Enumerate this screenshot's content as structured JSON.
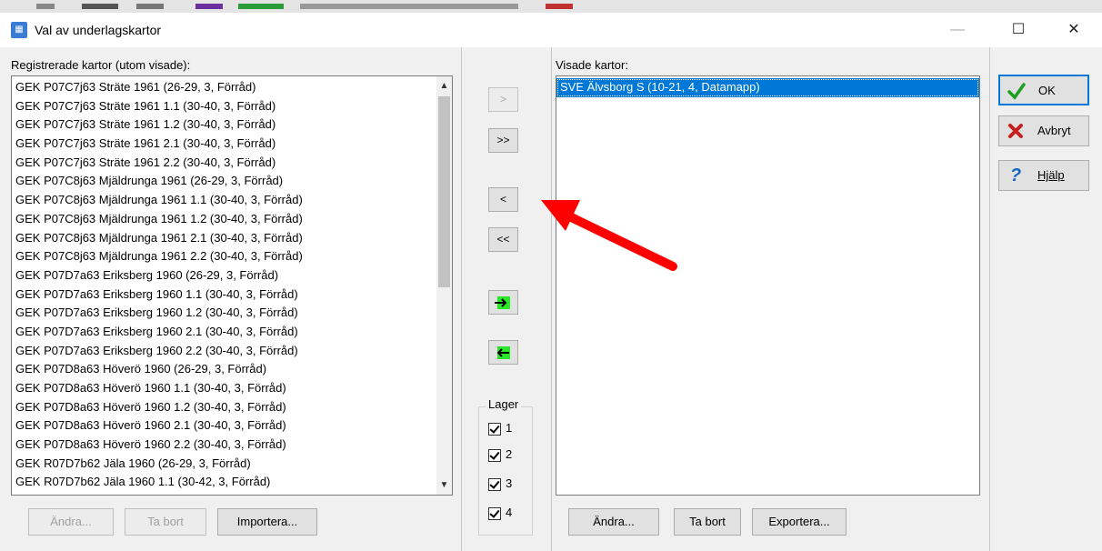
{
  "window": {
    "title": "Val av underlagskartor",
    "minimize_glyph": "—",
    "maximize_glyph": "☐",
    "close_glyph": "✕"
  },
  "left": {
    "label": "Registrerade kartor (utom visade):",
    "items": [
      "GEK P07C7j63 Sträte  1961 (26-29, 3, Förråd)",
      "GEK P07C7j63 Sträte  1961 1.1 (30-40, 3, Förråd)",
      "GEK P07C7j63 Sträte  1961 1.2 (30-40, 3, Förråd)",
      "GEK P07C7j63 Sträte  1961 2.1 (30-40, 3, Förråd)",
      "GEK P07C7j63 Sträte  1961 2.2 (30-40, 3, Förråd)",
      "GEK P07C8j63 Mjäldrunga 1961 (26-29, 3, Förråd)",
      "GEK P07C8j63 Mjäldrunga 1961 1.1 (30-40, 3, Förråd)",
      "GEK P07C8j63 Mjäldrunga 1961 1.2 (30-40, 3, Förråd)",
      "GEK P07C8j63 Mjäldrunga 1961 2.1 (30-40, 3, Förråd)",
      "GEK P07C8j63 Mjäldrunga 1961 2.2 (30-40, 3, Förråd)",
      "GEK P07D7a63 Eriksberg 1960 (26-29, 3, Förråd)",
      "GEK P07D7a63 Eriksberg 1960 1.1 (30-40, 3, Förråd)",
      "GEK P07D7a63 Eriksberg 1960 1.2 (30-40, 3, Förråd)",
      "GEK P07D7a63 Eriksberg 1960 2.1 (30-40, 3, Förråd)",
      "GEK P07D7a63 Eriksberg 1960 2.2 (30-40, 3, Förråd)",
      "GEK P07D8a63 Höverö 1960 (26-29, 3, Förråd)",
      "GEK P07D8a63 Höverö 1960 1.1 (30-40, 3, Förråd)",
      "GEK P07D8a63 Höverö 1960 1.2 (30-40, 3, Förråd)",
      "GEK P07D8a63 Höverö 1960 2.1 (30-40, 3, Förråd)",
      "GEK P07D8a63 Höverö 1960 2.2 (30-40, 3, Förråd)",
      "GEK R07D7b62 Jäla 1960 (26-29, 3, Förråd)",
      "GEK R07D7b62 Jäla 1960 1.1 (30-42, 3, Förråd)"
    ],
    "buttons": {
      "edit": "Ändra...",
      "remove": "Ta bort",
      "import": "Importera..."
    }
  },
  "middle": {
    "add_one": ">",
    "add_all": ">>",
    "remove_one": "<",
    "remove_all": "<<",
    "layer_group": "Lager",
    "layers": [
      "1",
      "2",
      "3",
      "4"
    ]
  },
  "right": {
    "label": "Visade kartor:",
    "items": [
      "SVE Älvsborg S (10-21, 4, Datamapp)"
    ],
    "buttons": {
      "edit": "Ändra...",
      "remove": "Ta bort",
      "export": "Exportera..."
    }
  },
  "actions": {
    "ok": "OK",
    "cancel": "Avbryt",
    "help": "Hjälp"
  },
  "colors": {
    "selection": "#0078d7",
    "accent_arrow": "#ff0000",
    "move_green": "#28e828"
  }
}
